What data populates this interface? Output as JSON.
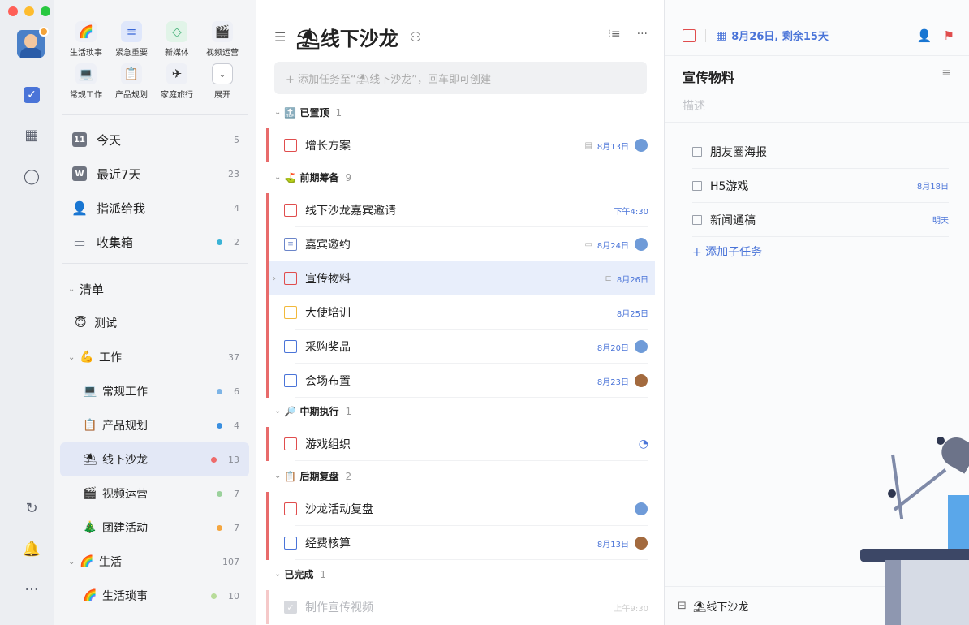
{
  "quick_filters": [
    {
      "label": "生活琐事",
      "icon": "🌈",
      "icon_name": "rainbow-icon",
      "style": ""
    },
    {
      "label": "紧急重要",
      "icon": "≡",
      "icon_name": "filter-icon",
      "style": "blue"
    },
    {
      "label": "新媒体",
      "icon": "◇",
      "icon_name": "tag-icon",
      "style": "green"
    },
    {
      "label": "视频运营",
      "icon": "🎬",
      "icon_name": "clapper-icon",
      "style": ""
    },
    {
      "label": "常规工作",
      "icon": "💻",
      "icon_name": "laptop-icon",
      "style": ""
    },
    {
      "label": "产品规划",
      "icon": "📋",
      "icon_name": "clipboard-icon",
      "style": ""
    },
    {
      "label": "家庭旅行",
      "icon": "✈",
      "icon_name": "airplane-icon",
      "style": ""
    },
    {
      "label": "展开",
      "icon": "⌄",
      "icon_name": "chevron-down-icon",
      "style": "box"
    }
  ],
  "smart_lists": [
    {
      "label": "今天",
      "count": "5",
      "icon": "11",
      "icon_name": "calendar-today-icon"
    },
    {
      "label": "最近7天",
      "count": "23",
      "icon": "W",
      "icon_name": "calendar-week-icon"
    },
    {
      "label": "指派给我",
      "count": "4",
      "icon": "👤",
      "icon_name": "person-icon"
    },
    {
      "label": "收集箱",
      "count": "2",
      "icon": "▭",
      "icon_name": "inbox-icon",
      "dot": "#3bb3d6"
    }
  ],
  "lists_header": "清单",
  "lists": [
    {
      "label": "测试",
      "emoji": "😇",
      "count": "",
      "level": 1,
      "chev": ""
    },
    {
      "label": "工作",
      "emoji": "💪",
      "count": "37",
      "level": 0,
      "chev": "⌄"
    },
    {
      "label": "常规工作",
      "emoji": "💻",
      "count": "6",
      "level": 2,
      "dot": "#7db4e6"
    },
    {
      "label": "产品规划",
      "emoji": "📋",
      "count": "4",
      "level": 2,
      "dot": "#3a8fe0"
    },
    {
      "label": "线下沙龙",
      "emoji": "⛱",
      "count": "13",
      "level": 2,
      "dot": "#ee6b6b",
      "selected": true
    },
    {
      "label": "视频运营",
      "emoji": "🎬",
      "count": "7",
      "level": 2,
      "dot": "#9bd19c"
    },
    {
      "label": "团建活动",
      "emoji": "🎄",
      "count": "7",
      "level": 2,
      "dot": "#f4a640"
    },
    {
      "label": "生活",
      "emoji": "🌈",
      "count": "107",
      "level": 0,
      "chev": "⌄"
    },
    {
      "label": "生活琐事",
      "emoji": "🌈",
      "count": "10",
      "level": 2,
      "dot": "#b8dc9a"
    }
  ],
  "task_list": {
    "title": "⛱线下沙龙",
    "add_placeholder": "+ 添加任务至“⛱线下沙龙”，回车即可创建",
    "sections": {
      "pinned": {
        "label": "🔝 已置顶",
        "count": "1"
      },
      "prep": {
        "label": "⛳ 前期筹备",
        "count": "9"
      },
      "mid": {
        "label": "🔎 中期执行",
        "count": "1"
      },
      "review": {
        "label": "📋 后期复盘",
        "count": "2"
      },
      "done": {
        "label": "已完成",
        "count": "1"
      }
    },
    "tasks": [
      {
        "name": "增长方案",
        "date": "8月13日",
        "meta_icon": "▤"
      },
      {
        "name": "线下沙龙嘉宾邀请",
        "date": "下午4:30"
      },
      {
        "name": "嘉宾邀约",
        "date": "8月24日",
        "meta_icon": "▭"
      },
      {
        "name": "宣传物料",
        "date": "8月26日",
        "meta_icon": "⊏"
      },
      {
        "name": "大使培训",
        "date": "8月25日"
      },
      {
        "name": "采购奖品",
        "date": "8月20日"
      },
      {
        "name": "会场布置",
        "date": "8月23日"
      },
      {
        "name": "游戏组织",
        "date": ""
      },
      {
        "name": "沙龙活动复盘",
        "date": ""
      },
      {
        "name": "经费核算",
        "date": "8月13日"
      },
      {
        "name": "制作宣传视频",
        "date": "上午9:30"
      }
    ]
  },
  "detail": {
    "due": "8月26日, 剩余15天",
    "title": "宣传物料",
    "desc_placeholder": "描述",
    "subtasks": [
      {
        "name": "朋友圈海报",
        "date": ""
      },
      {
        "name": "H5游戏",
        "date": "8月18日"
      },
      {
        "name": "新闻通稿",
        "date": "明天"
      }
    ],
    "add_subtask": "+ 添加子任务",
    "footer_list": "⛱线下沙龙"
  }
}
